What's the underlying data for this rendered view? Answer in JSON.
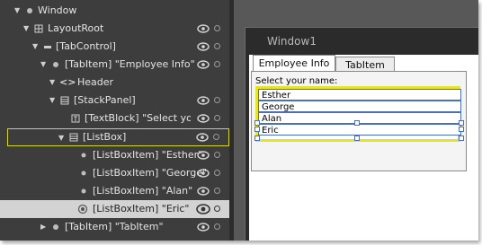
{
  "tree": {
    "rows": [
      {
        "label": "Window",
        "expanded": true,
        "icon": "window-icon"
      },
      {
        "label": "LayoutRoot",
        "expanded": true,
        "icon": "grid-icon"
      },
      {
        "label": "[TabControl]",
        "expanded": true,
        "icon": "tabcontrol-icon"
      },
      {
        "label": "[TabItem] \"Employee Info\"",
        "expanded": true,
        "icon": "tabitem-icon"
      },
      {
        "label": "Header",
        "expanded": true,
        "icon": "code-brackets-icon"
      },
      {
        "label": "[StackPanel]",
        "expanded": true,
        "icon": "stackpanel-icon"
      },
      {
        "label": "[TextBlock] \"Select your n",
        "expanded": null,
        "icon": "textblock-icon"
      },
      {
        "label": "[ListBox]",
        "expanded": true,
        "icon": "listbox-icon",
        "selected": true
      },
      {
        "label": "[ListBoxItem] \"Esther\"",
        "expanded": null,
        "icon": "listboxitem-icon"
      },
      {
        "label": "[ListBoxItem] \"George\"",
        "expanded": null,
        "icon": "listboxitem-icon"
      },
      {
        "label": "[ListBoxItem] \"Alan\"",
        "expanded": null,
        "icon": "listboxitem-icon"
      },
      {
        "label": "[ListBoxItem] \"Eric\"",
        "expanded": null,
        "icon": "listboxitem-icon",
        "hovered": true
      },
      {
        "label": "[TabItem] \"TabItem\"",
        "expanded": false,
        "icon": "tabitem-icon"
      }
    ]
  },
  "artboard": {
    "window_title": "Window1",
    "tabs": [
      {
        "label": "Employee Info",
        "active": true
      },
      {
        "label": "TabItem",
        "active": false
      }
    ],
    "prompt": "Select your name:",
    "items": [
      "Esther",
      "George",
      "Alan",
      "Eric"
    ]
  },
  "colors": {
    "selection": "#d6d62a",
    "listbox_border": "#e4e42e",
    "item_border": "#4b6fb8"
  }
}
